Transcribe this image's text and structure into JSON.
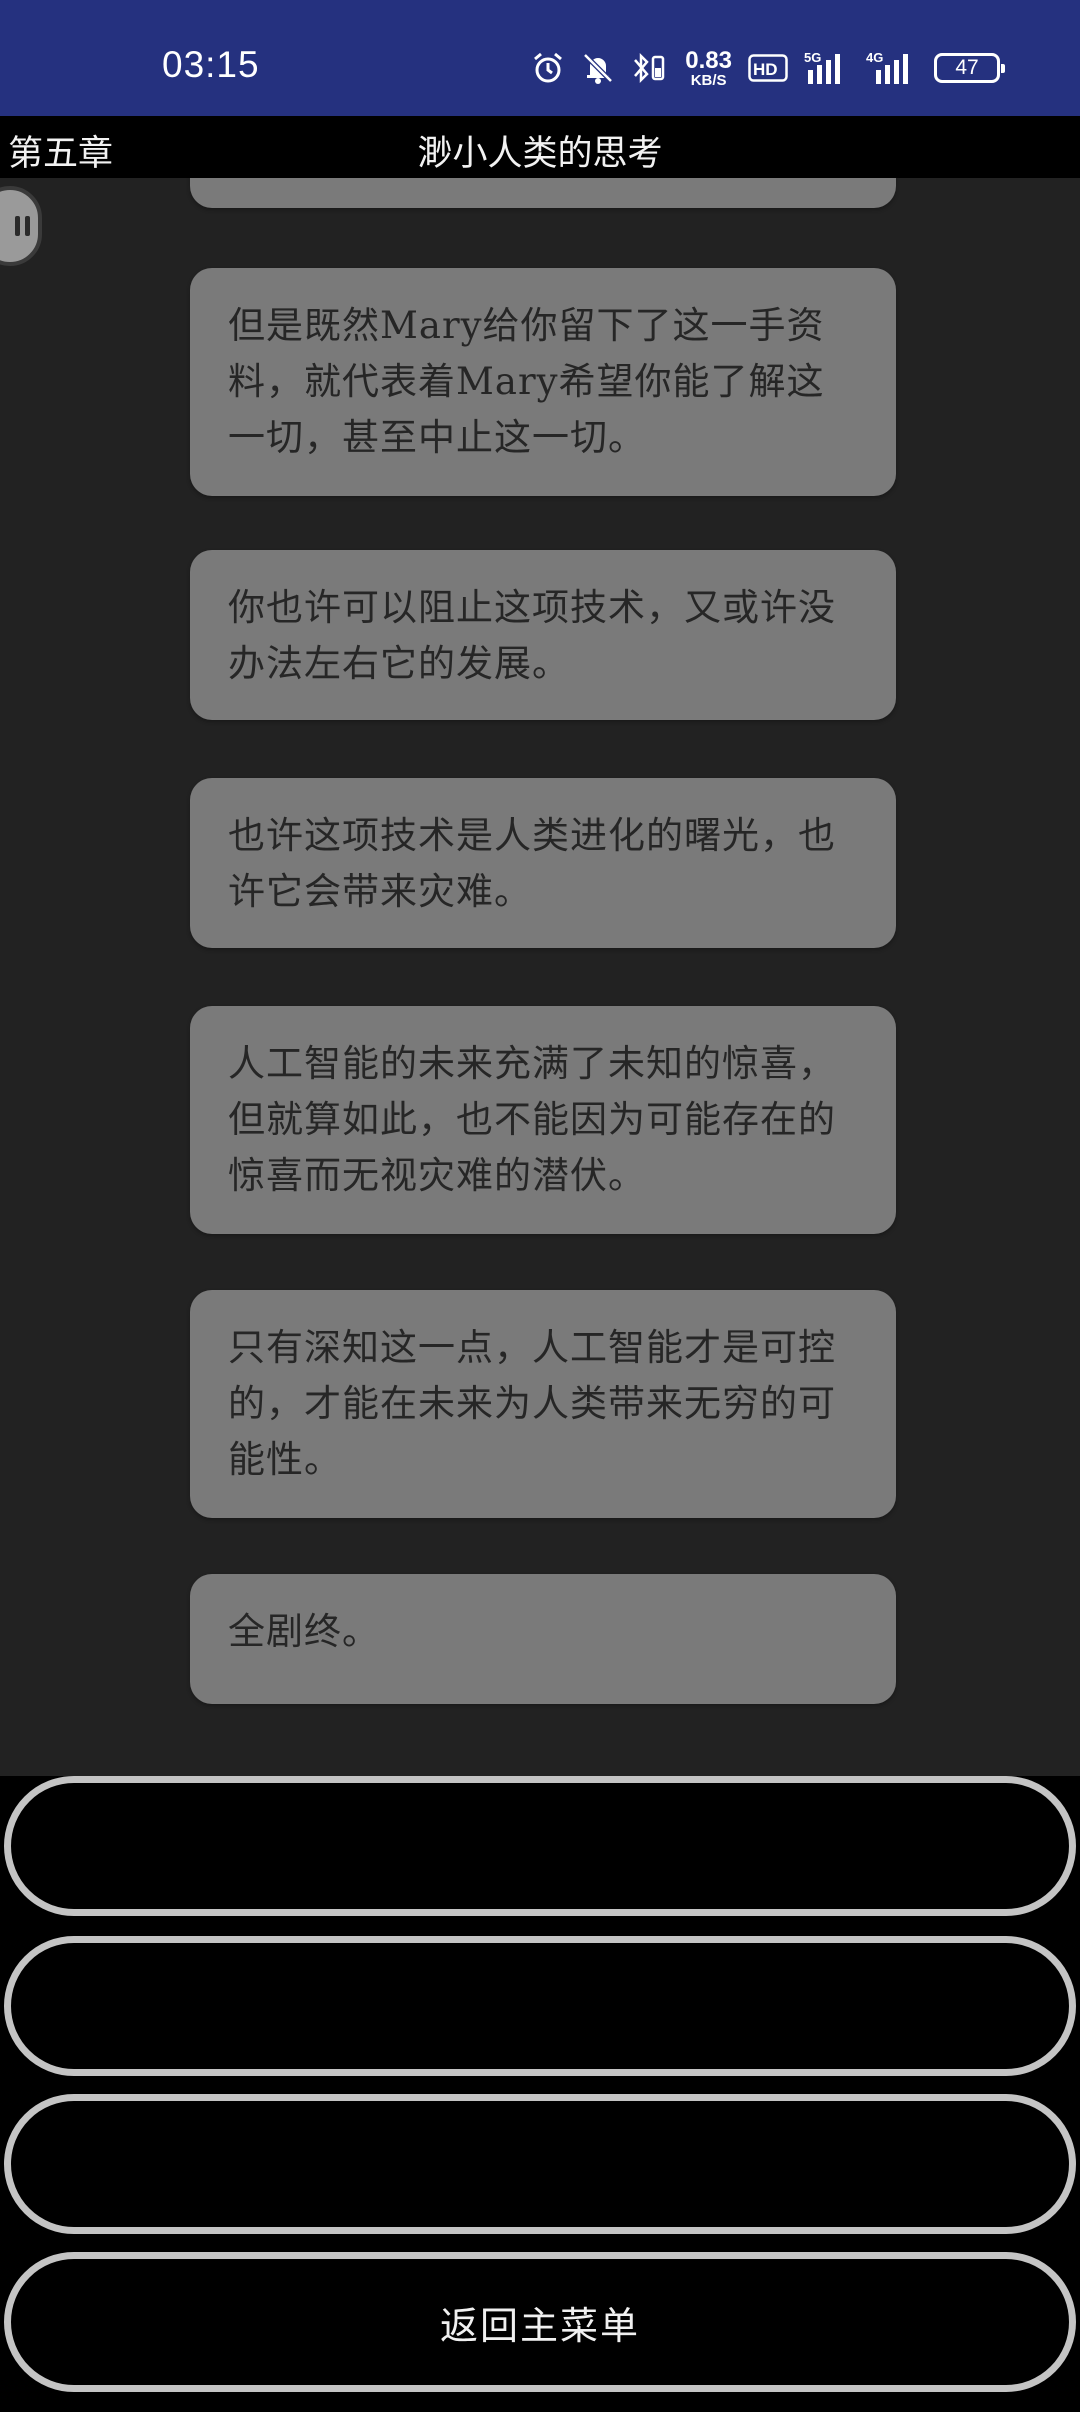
{
  "status_bar": {
    "time": "03:15",
    "net_speed_value": "0.83",
    "net_speed_unit": "KB/S",
    "hd_label": "HD",
    "signal1_label": "5G",
    "signal2_label": "4G",
    "battery": "47"
  },
  "header": {
    "chapter": "第五章",
    "title": "渺小人类的思考"
  },
  "dialogue": [
    "但是既然Mary给你留下了这一手资料，就代表着Mary希望你能了解这一切，甚至中止这一切。",
    "你也许可以阻止这项技术，又或许没办法左右它的发展。",
    "也许这项技术是人类进化的曙光，也许它会带来灾难。",
    "人工智能的未来充满了未知的惊喜，但就算如此，也不能因为可能存在的惊喜而无视灾难的潜伏。",
    "只有深知这一点，人工智能才是可控的，才能在未来为人类带来无穷的可能性。",
    "全剧终。"
  ],
  "choices": [
    "",
    "",
    "",
    "返回主菜单"
  ]
}
